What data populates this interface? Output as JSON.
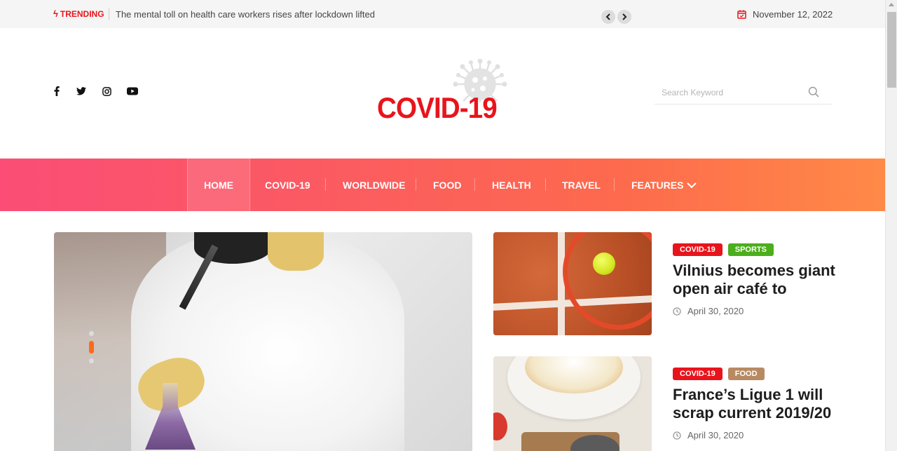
{
  "topbar": {
    "trending_label": "TRENDING",
    "trending_icon": "bolt-icon",
    "headline": "The mental toll on health care workers rises after lockdown lifted",
    "prev_label": "‹",
    "next_label": "›",
    "date": "November 12, 2022"
  },
  "header": {
    "social": [
      "facebook-icon",
      "twitter-icon",
      "instagram-icon",
      "youtube-icon"
    ],
    "logo_text": "COVID-19",
    "search_placeholder": "Search Keyword"
  },
  "nav": {
    "items": [
      {
        "label": "HOME",
        "active": true
      },
      {
        "label": "COVID-19"
      },
      {
        "label": "WORLDWIDE"
      },
      {
        "label": "FOOD"
      },
      {
        "label": "HEALTH"
      },
      {
        "label": "TRAVEL"
      },
      {
        "label": "FEATURES",
        "dropdown": true
      }
    ]
  },
  "hero": {
    "slides_count": 3,
    "active_slide": 2
  },
  "articles": [
    {
      "tags": [
        "COVID-19",
        "SPORTS"
      ],
      "title": "Vilnius becomes giant open air café to",
      "date": "April 30, 2020"
    },
    {
      "tags": [
        "COVID-19",
        "FOOD"
      ],
      "title": "France’s Ligue 1 will scrap current 2019/20",
      "date": "April 30, 2020"
    }
  ],
  "colors": {
    "brand_red": "#e8141c",
    "nav_gradient_start": "#fb4d76",
    "nav_gradient_end": "#ff8a47",
    "sports_tag": "#4cae1c",
    "food_tag": "#b88a62"
  }
}
